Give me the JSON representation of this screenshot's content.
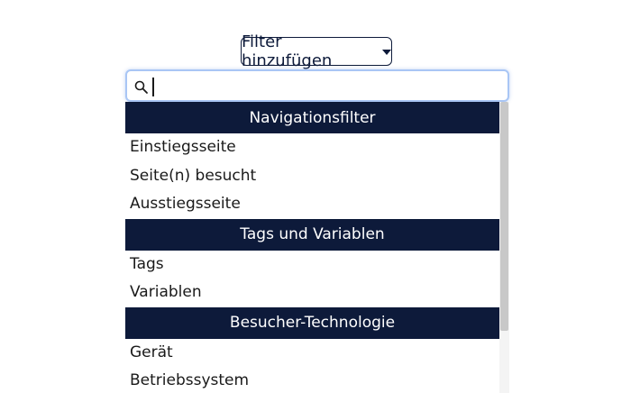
{
  "filter_button": {
    "label": "Filter hinzufügen",
    "icon": "caret-down-icon"
  },
  "search": {
    "value": "",
    "placeholder": "",
    "icon": "search-icon"
  },
  "groups": [
    {
      "header": "Navigationsfilter",
      "options": [
        "Einstiegsseite",
        "Seite(n) besucht",
        "Ausstiegsseite"
      ]
    },
    {
      "header": "Tags und Variablen",
      "options": [
        "Tags",
        "Variablen"
      ]
    },
    {
      "header": "Besucher-Technologie",
      "options": [
        "Gerät",
        "Betriebssystem"
      ]
    }
  ],
  "colors": {
    "header_bg": "#0d1a3a",
    "header_text": "#ffffff",
    "search_border": "#a9c6f5"
  }
}
